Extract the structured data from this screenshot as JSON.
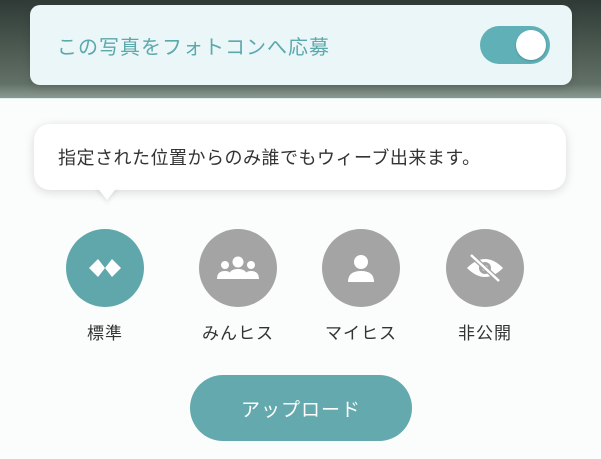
{
  "contest": {
    "label": "この写真をフォトコンへ応募",
    "toggle_on": true,
    "toggle_color": "#5fb1b7"
  },
  "tooltip": {
    "text": "指定された位置からのみ誰でもウィーブ出来ます。"
  },
  "visibility_options": [
    {
      "label": "標準",
      "icon": "double-diamond-icon",
      "selected": true
    },
    {
      "label": "みんヒス",
      "icon": "group-icon",
      "selected": false
    },
    {
      "label": "マイヒス",
      "icon": "person-icon",
      "selected": false
    },
    {
      "label": "非公開",
      "icon": "eye-off-icon",
      "selected": false
    }
  ],
  "colors": {
    "accent": "#5fa7ab",
    "inactive": "#a4a4a4"
  },
  "upload": {
    "label": "アップロード"
  }
}
